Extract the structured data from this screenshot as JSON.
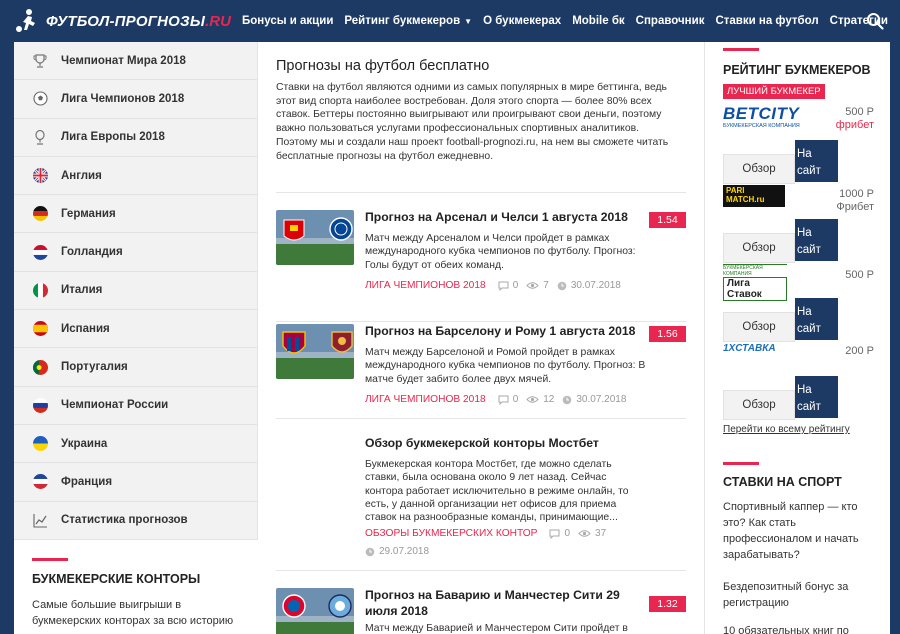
{
  "header": {
    "logo_text": "ФУТБОЛ-ПРОГНОЗЫ",
    "logo_suffix": ".RU",
    "nav": [
      {
        "label": "Бонусы и акции"
      },
      {
        "label": "Рейтинг букмекеров"
      },
      {
        "label": "О букмекерах"
      },
      {
        "label": "Mobile бк"
      },
      {
        "label": "Справочник"
      },
      {
        "label": "Ставки на футбол"
      },
      {
        "label": "Стратегии"
      }
    ],
    "nav_caret_item": "Рейтинг букмекеров",
    "search_icon": "search-icon"
  },
  "sidebar": {
    "items": [
      {
        "label": "Чемпионат Мира 2018",
        "icon": "trophy-icon"
      },
      {
        "label": "Лига Чемпионов 2018",
        "icon": "ball-icon"
      },
      {
        "label": "Лига Европы 2018",
        "icon": "cup-icon"
      },
      {
        "label": "Англия",
        "icon": "flag-uk-icon"
      },
      {
        "label": "Германия",
        "icon": "flag-germany-icon"
      },
      {
        "label": "Голландия",
        "icon": "flag-netherlands-icon"
      },
      {
        "label": "Италия",
        "icon": "flag-italy-icon"
      },
      {
        "label": "Испания",
        "icon": "flag-spain-icon"
      },
      {
        "label": "Португалия",
        "icon": "flag-portugal-icon"
      },
      {
        "label": "Чемпионат России",
        "icon": "flag-russia-icon"
      },
      {
        "label": "Украина",
        "icon": "flag-ukraine-icon"
      },
      {
        "label": "Франция",
        "icon": "flag-france-icon"
      },
      {
        "label": "Статистика прогнозов",
        "icon": "chart-icon"
      }
    ],
    "bookmakers": {
      "title": "БУКМЕКЕРСКИЕ КОНТОРЫ",
      "text": "Самые большие выигрыши в букмекерских конторах за всю историю"
    }
  },
  "main": {
    "title": "Прогнозы на футбол бесплатно",
    "intro": "Ставки на футбол являются одними из самых популярных в мире беттинга, ведь этот вид спорта наиболее востребован. Доля этого спорта — более 80% всех ставок. Беттеры постоянно выигрывают или проигрывают свои деньги, поэтому важно пользоваться услугами профессиональных спортивных аналитиков. Поэтому мы и создали наш проект football-prognozi.ru, на нем вы сможете читать бесплатные прогнозы на футбол ежедневно.",
    "posts": [
      {
        "title": "Прогноз на Арсенал и Челси 1 августа 2018",
        "odds": "1.54",
        "text": "Матч между Арсеналом и Челси пройдет в рамках международного кубка чемпионов по футболу. Прогноз: Голы будут от обеих команд.",
        "category": "ЛИГА ЧЕМПИОНОВ 2018",
        "comments": "0",
        "views": "7",
        "date": "30.07.2018"
      },
      {
        "title": "Прогноз на Барселону и Рому 1 августа 2018",
        "odds": "1.56",
        "text": "Матч между Барселоной и Ромой пройдет в рамках международного кубка чемпионов по футболу. Прогноз: В матче будет забито более двух мячей.",
        "category": "ЛИГА ЧЕМПИОНОВ 2018",
        "comments": "0",
        "views": "12",
        "date": "30.07.2018"
      },
      {
        "title": "Обзор букмекерской конторы Мостбет",
        "text": "Букмекерская контора Мостбет, где можно сделать ставки, была основана около 9 лет назад. Сейчас контора работает исключительно в режиме онлайн, то есть, у данной организации нет офисов для приема ставок на разнообразные команды, принимающие...",
        "category": "ОБЗОРЫ БУКМЕКЕРСКИХ КОНТОР",
        "comments": "0",
        "views": "37",
        "date": "29.07.2018"
      },
      {
        "title": "Прогноз на Баварию и Манчестер Сити 29 июля 2018",
        "odds": "1.32",
        "text": "Матч между Баварией и Манчестером Сити пройдет в"
      }
    ]
  },
  "right": {
    "rating_title": "РЕЙТИНГ БУКМЕКЕРОВ",
    "best_badge": "ЛУЧШИЙ БУКМЕКЕР",
    "review_label": "Обзор",
    "site_label": "На сайт",
    "bookmakers": [
      {
        "name": "BETCITY",
        "sub": "БУКМЕКЕРСКАЯ КОМПАНИЯ",
        "bonus": "500 Р",
        "bonus_note": "фрибет"
      },
      {
        "name": "PARI MATCH.ru",
        "bonus": "1000 Р",
        "bonus_note": "Фрибет"
      },
      {
        "name": "Лига Ставок",
        "sub": "БУКМЕКЕРСКАЯ КОМПАНИЯ",
        "bonus": "500 Р"
      },
      {
        "name": "1XСТАВКА",
        "bonus": "200 Р"
      }
    ],
    "all_rating_link": "Перейти ко всему рейтингу",
    "sport_title": "СТАВКИ НА СПОРТ",
    "sport_items": [
      "Спортивный каппер — кто это? Как стать профессионалом и начать зарабатывать?",
      "Бездепозитный бонус за регистрацию",
      "10 обязательных книг по"
    ]
  },
  "colors": {
    "navy": "#1c3a63",
    "accent_red": "#e8264f",
    "sidebar_bg": "#f2f2f2"
  }
}
